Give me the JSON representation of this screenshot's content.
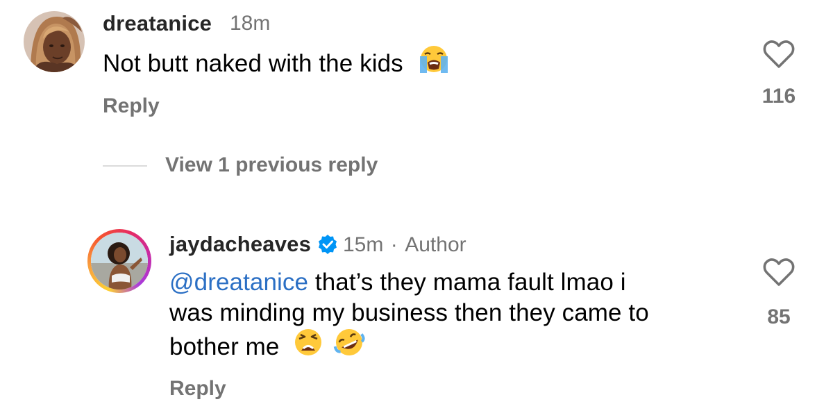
{
  "comments": [
    {
      "username": "dreatanice",
      "time": "18m",
      "text": "Not butt naked with the kids",
      "emoji": "loudly-crying-face-emoji",
      "reply_label": "Reply",
      "like_count": "116",
      "like_icon": "heart-outline-icon"
    },
    {
      "username": "jaydacheaves",
      "verified_icon": "verified-badge-icon",
      "time": "15m",
      "separator": "·",
      "author_label": "Author",
      "mention": "@dreatanice",
      "text_line1": " that’s they mama fault lmao i",
      "text_line2": "was minding my business then they came to",
      "text_line3": "bother me",
      "emojis": [
        "weary-face-emoji",
        "rolling-on-floor-laughing-emoji"
      ],
      "reply_label": "Reply",
      "like_count": "85",
      "like_icon": "heart-outline-icon"
    }
  ],
  "view_replies": {
    "label": "View 1 previous reply"
  },
  "colors": {
    "username": "#262626",
    "secondary": "#737373",
    "mention": "#2b6fc4",
    "verified": "#0095f6",
    "divider": "#dbdbdb"
  }
}
